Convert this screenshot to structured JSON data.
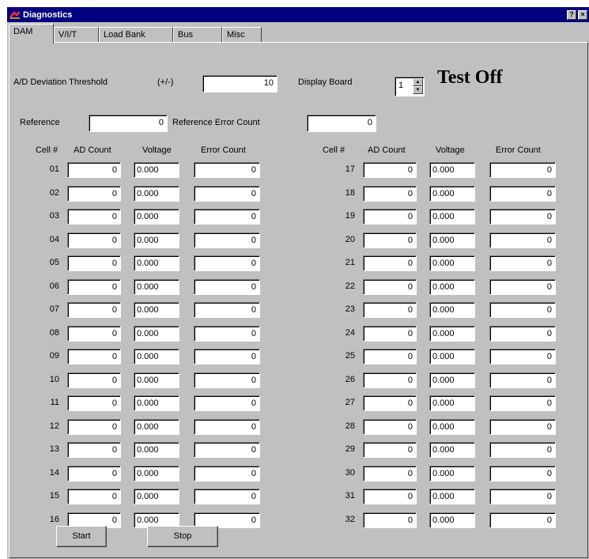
{
  "window": {
    "title": "Diagnostics"
  },
  "tabs": [
    {
      "label": "DAM",
      "active": true
    },
    {
      "label": "V/I/T",
      "active": false
    },
    {
      "label": "Load Bank",
      "active": false
    },
    {
      "label": "Bus",
      "active": false
    },
    {
      "label": "Misc",
      "active": false
    }
  ],
  "threshold": {
    "label": "A/D Deviation Threshold",
    "unit": "(+/-)",
    "value": "10"
  },
  "display_board": {
    "label": "Display Board",
    "value": "1"
  },
  "test_status": "Test Off",
  "reference": {
    "label": "Reference",
    "value": "0",
    "error_label": "Reference Error Count",
    "error_value": "0"
  },
  "columns": {
    "cell": "Cell #",
    "ad": "AD Count",
    "voltage": "Voltage",
    "error": "Error Count"
  },
  "cells_left": [
    {
      "num": "01",
      "ad": "0",
      "voltage": "0.000",
      "error": "0"
    },
    {
      "num": "02",
      "ad": "0",
      "voltage": "0.000",
      "error": "0"
    },
    {
      "num": "03",
      "ad": "0",
      "voltage": "0.000",
      "error": "0"
    },
    {
      "num": "04",
      "ad": "0",
      "voltage": "0.000",
      "error": "0"
    },
    {
      "num": "05",
      "ad": "0",
      "voltage": "0.000",
      "error": "0"
    },
    {
      "num": "06",
      "ad": "0",
      "voltage": "0.000",
      "error": "0"
    },
    {
      "num": "07",
      "ad": "0",
      "voltage": "0.000",
      "error": "0"
    },
    {
      "num": "08",
      "ad": "0",
      "voltage": "0.000",
      "error": "0"
    },
    {
      "num": "09",
      "ad": "0",
      "voltage": "0.000",
      "error": "0"
    },
    {
      "num": "10",
      "ad": "0",
      "voltage": "0.000",
      "error": "0"
    },
    {
      "num": "11",
      "ad": "0",
      "voltage": "0.000",
      "error": "0"
    },
    {
      "num": "12",
      "ad": "0",
      "voltage": "0.000",
      "error": "0"
    },
    {
      "num": "13",
      "ad": "0",
      "voltage": "0.000",
      "error": "0"
    },
    {
      "num": "14",
      "ad": "0",
      "voltage": "0.000",
      "error": "0"
    },
    {
      "num": "15",
      "ad": "0",
      "voltage": "0.000",
      "error": "0"
    },
    {
      "num": "16",
      "ad": "0",
      "voltage": "0.000",
      "error": "0"
    }
  ],
  "cells_right": [
    {
      "num": "17",
      "ad": "0",
      "voltage": "0.000",
      "error": "0"
    },
    {
      "num": "18",
      "ad": "0",
      "voltage": "0.000",
      "error": "0"
    },
    {
      "num": "19",
      "ad": "0",
      "voltage": "0.000",
      "error": "0"
    },
    {
      "num": "20",
      "ad": "0",
      "voltage": "0.000",
      "error": "0"
    },
    {
      "num": "21",
      "ad": "0",
      "voltage": "0.000",
      "error": "0"
    },
    {
      "num": "22",
      "ad": "0",
      "voltage": "0.000",
      "error": "0"
    },
    {
      "num": "23",
      "ad": "0",
      "voltage": "0.000",
      "error": "0"
    },
    {
      "num": "24",
      "ad": "0",
      "voltage": "0.000",
      "error": "0"
    },
    {
      "num": "25",
      "ad": "0",
      "voltage": "0.000",
      "error": "0"
    },
    {
      "num": "26",
      "ad": "0",
      "voltage": "0.000",
      "error": "0"
    },
    {
      "num": "27",
      "ad": "0",
      "voltage": "0.000",
      "error": "0"
    },
    {
      "num": "28",
      "ad": "0",
      "voltage": "0.000",
      "error": "0"
    },
    {
      "num": "29",
      "ad": "0",
      "voltage": "0.000",
      "error": "0"
    },
    {
      "num": "30",
      "ad": "0",
      "voltage": "0.000",
      "error": "0"
    },
    {
      "num": "31",
      "ad": "0",
      "voltage": "0.000",
      "error": "0"
    },
    {
      "num": "32",
      "ad": "0",
      "voltage": "0.000",
      "error": "0"
    }
  ],
  "buttons": {
    "start": "Start",
    "stop": "Stop"
  },
  "icons": {
    "app": "app-icon",
    "help": "help-icon",
    "close": "close-icon"
  },
  "colors": {
    "titlebar": "#000080",
    "face": "#c0c0c0"
  }
}
